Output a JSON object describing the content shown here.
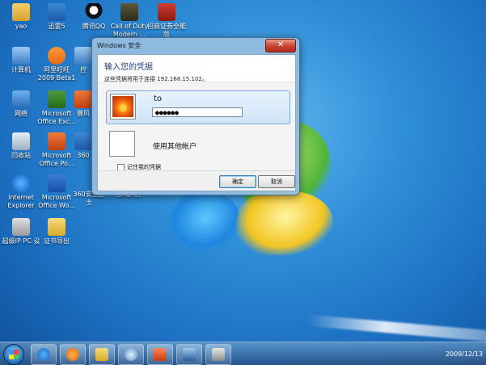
{
  "desktop_icons": [
    {
      "label": "yao",
      "icon": "user-folder-icon"
    },
    {
      "label": "迅雷5",
      "icon": "xunlei-icon"
    },
    {
      "label": "腾讯QQ",
      "icon": "qq-icon"
    },
    {
      "label": "Call of Duty Modern ...",
      "icon": "game-icon"
    },
    {
      "label": "招商证券全能版",
      "icon": "stock-app-icon"
    },
    {
      "label": "计算机",
      "icon": "computer-icon"
    },
    {
      "label": "阿里旺旺 2009 Beta1",
      "icon": "aliwangwang-icon"
    },
    {
      "label": "控",
      "icon": "control-icon"
    },
    {
      "label": "网络",
      "icon": "network-icon"
    },
    {
      "label": "Microsoft Office Exc...",
      "icon": "excel-icon"
    },
    {
      "label": "暴风",
      "icon": "storm-player-icon"
    },
    {
      "label": "回收站",
      "icon": "recycle-bin-icon"
    },
    {
      "label": "Microsoft Office Po...",
      "icon": "powerpoint-icon"
    },
    {
      "label": "360",
      "icon": "360-icon"
    },
    {
      "label": "Internet Explorer",
      "icon": "ie-icon"
    },
    {
      "label": "Microsoft Office Wo...",
      "icon": "word-icon"
    },
    {
      "label": "360安全卫士",
      "icon": "360-safe-icon"
    },
    {
      "label": "游戏大厅",
      "icon": "game-hall-icon"
    },
    {
      "label": "超级IP PC 设",
      "icon": "tool-icon"
    },
    {
      "label": "证书导出",
      "icon": "folder-icon"
    }
  ],
  "dialog": {
    "title": "Windows 安全",
    "close": "✕",
    "heading": "输入您的凭据",
    "subheading": "这些凭据将用于连接 192.168.15.102。",
    "username": "to",
    "password_mask": "●●●●●●",
    "other_account": "使用其他帐户",
    "remember": "记住我的凭据",
    "ok": "确定",
    "cancel": "取消"
  },
  "taskbar": {
    "clock": "2009/12/13",
    "pinned": [
      "ie-icon",
      "media-player-icon",
      "explorer-icon",
      "browser-icon",
      "camera-icon",
      "network-tool-icon",
      "paint-icon"
    ]
  }
}
